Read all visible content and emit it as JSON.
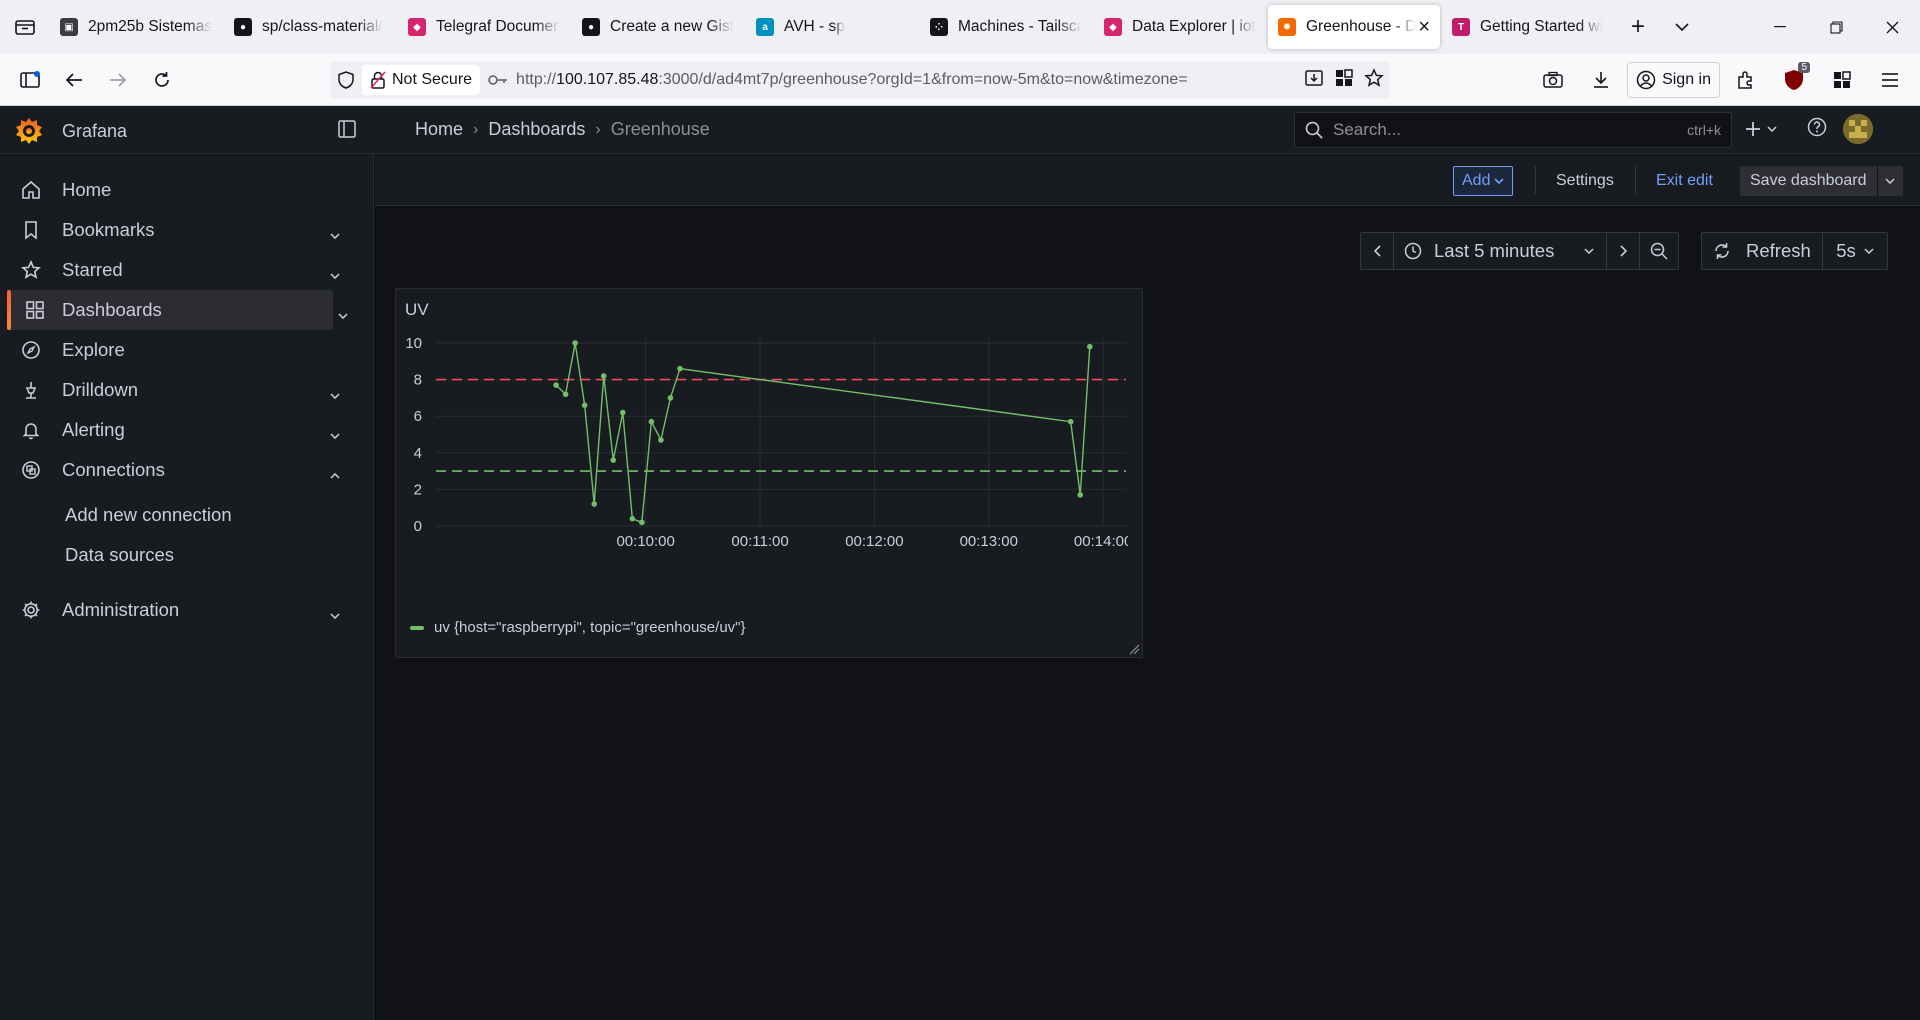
{
  "browser": {
    "tabs": [
      {
        "title": "2pm25b Sistemas",
        "icon": "contact-card-icon",
        "playing": true,
        "active": false
      },
      {
        "title": "sp/class-material/",
        "icon": "github-icon",
        "playing": true,
        "active": false
      },
      {
        "title": "Telegraf Documen",
        "icon": "influx-icon",
        "playing": false,
        "active": false
      },
      {
        "title": "Create a new Gist",
        "icon": "github-icon",
        "playing": true,
        "active": false
      },
      {
        "title": "AVH - sp",
        "icon": "arm-icon",
        "playing": false,
        "active": false
      },
      {
        "title": "Machines - Tailsca",
        "icon": "tailscale-icon",
        "playing": false,
        "active": false
      },
      {
        "title": "Data Explorer | iot",
        "icon": "influx-icon",
        "playing": false,
        "active": false
      },
      {
        "title": "Greenhouse - D",
        "icon": "grafana-icon",
        "playing": false,
        "active": true
      },
      {
        "title": "Getting Started wi",
        "icon": "tns-icon",
        "playing": false,
        "active": false
      }
    ],
    "not_secure_label": "Not Secure",
    "url_prefix": "http://",
    "url_host": "100.107.85.48",
    "url_rest": ":3000/d/ad4mt7p/greenhouse?orgId=1&from=now-5m&to=now&timezone=",
    "sign_in_label": "Sign in",
    "ublock_badge": "5"
  },
  "grafana": {
    "brand": "Grafana",
    "breadcrumb": [
      "Home",
      "Dashboards",
      "Greenhouse"
    ],
    "search_placeholder": "Search...",
    "search_shortcut": "ctrl+k",
    "nav": [
      {
        "label": "Home",
        "icon": "home-icon",
        "chevron": ""
      },
      {
        "label": "Bookmarks",
        "icon": "bookmark-icon",
        "chevron": "down"
      },
      {
        "label": "Starred",
        "icon": "star-icon",
        "chevron": "down"
      },
      {
        "label": "Dashboards",
        "icon": "dashboards-grid-icon",
        "chevron": "down",
        "active": true
      },
      {
        "label": "Explore",
        "icon": "compass-icon",
        "chevron": ""
      },
      {
        "label": "Drilldown",
        "icon": "drilldown-icon",
        "chevron": "down"
      },
      {
        "label": "Alerting",
        "icon": "bell-icon",
        "chevron": "down"
      },
      {
        "label": "Connections",
        "icon": "connections-icon",
        "chevron": "up"
      },
      {
        "label": "Administration",
        "icon": "gear-icon",
        "chevron": "down"
      }
    ],
    "connections_sub": [
      "Add new connection",
      "Data sources"
    ],
    "toolbar": {
      "add_label": "Add",
      "settings_label": "Settings",
      "exit_edit_label": "Exit edit",
      "save_label": "Save dashboard"
    },
    "time_range": "Last 5 minutes",
    "refresh_label": "Refresh",
    "refresh_interval": "5s"
  },
  "panel": {
    "title": "UV",
    "legend": "uv {host=\"raspberrypi\", topic=\"greenhouse/uv\"}"
  },
  "colors": {
    "series": "#73bf69",
    "threshold_high": "#f2495c",
    "threshold_low": "#73bf69",
    "accent": "#6e9fff"
  },
  "chart_data": {
    "type": "line",
    "title": "UV",
    "xlabel": "",
    "ylabel": "",
    "ylim": [
      0,
      10
    ],
    "yticks": [
      0,
      2,
      4,
      6,
      8,
      10
    ],
    "xticks": [
      "00:10:00",
      "00:11:00",
      "00:12:00",
      "00:13:00",
      "00:14:00"
    ],
    "thresholds": [
      {
        "value": 8,
        "color": "red",
        "style": "dashed"
      },
      {
        "value": 3,
        "color": "green",
        "style": "dashed"
      }
    ],
    "series": [
      {
        "name": "uv {host=\"raspberrypi\", topic=\"greenhouse/uv\"}",
        "x": [
          "00:09:13",
          "00:09:18",
          "00:09:23",
          "00:09:28",
          "00:09:33",
          "00:09:38",
          "00:09:43",
          "00:09:48",
          "00:09:53",
          "00:09:58",
          "00:10:03",
          "00:10:08",
          "00:10:13",
          "00:10:18",
          "00:13:43",
          "00:13:48",
          "00:13:53"
        ],
        "values": [
          7.7,
          7.2,
          10.0,
          6.6,
          1.2,
          8.2,
          3.6,
          6.2,
          0.4,
          0.2,
          5.7,
          4.7,
          7.0,
          8.6,
          5.7,
          1.7,
          9.8
        ]
      }
    ],
    "grid": true,
    "legend_position": "bottom-left"
  }
}
